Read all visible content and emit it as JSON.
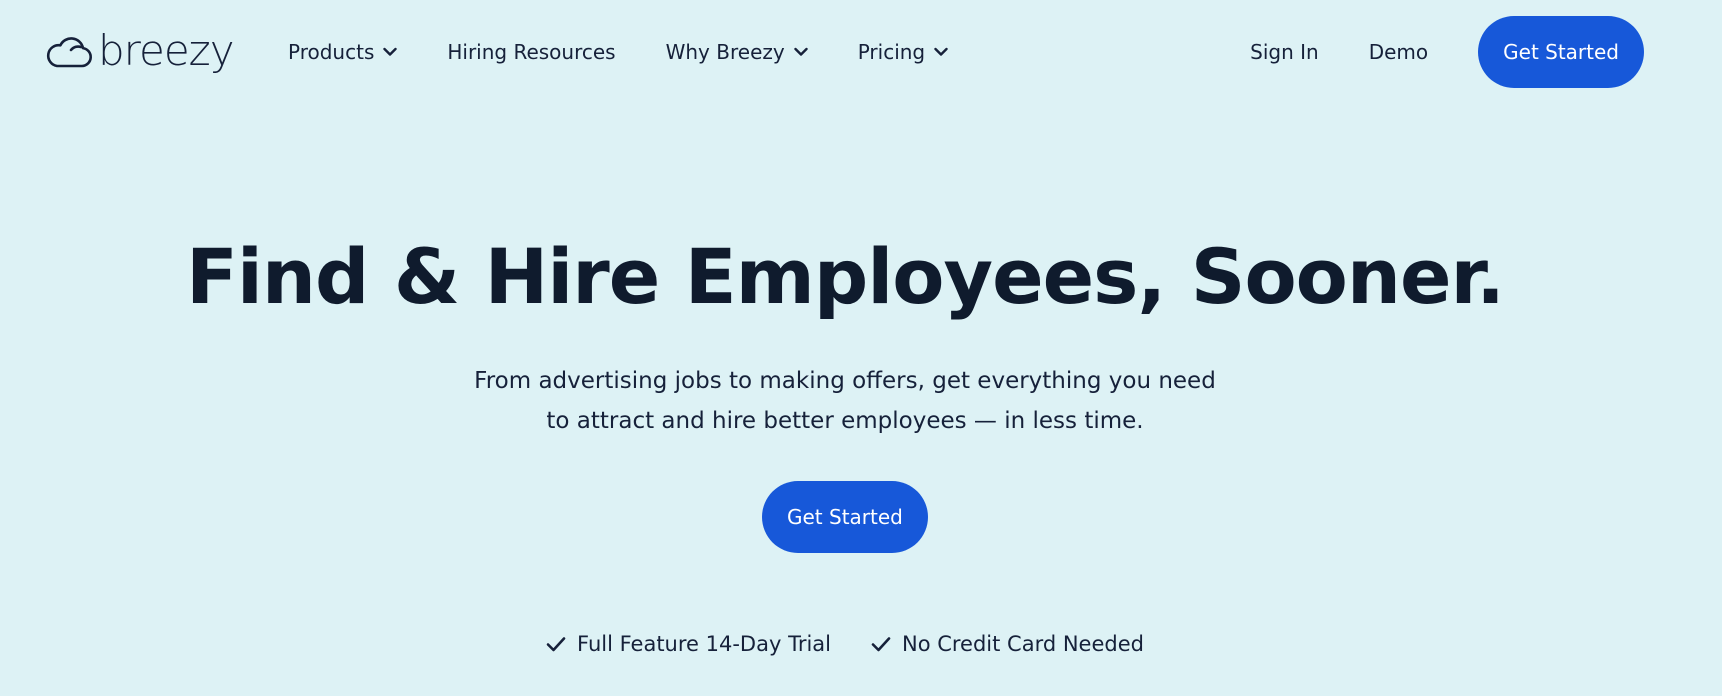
{
  "brand": {
    "logo_text": "breezy",
    "logo_icon": "cloud-icon"
  },
  "nav": {
    "items": [
      {
        "label": "Products",
        "has_dropdown": true
      },
      {
        "label": "Hiring Resources",
        "has_dropdown": false
      },
      {
        "label": "Why Breezy",
        "has_dropdown": true
      },
      {
        "label": "Pricing",
        "has_dropdown": true
      }
    ],
    "sign_in": "Sign In",
    "demo": "Demo",
    "get_started": "Get Started"
  },
  "hero": {
    "title": "Find & Hire Employees, Sooner.",
    "subtitle_line1": "From advertising jobs to making offers, get everything you need",
    "subtitle_line2": "to attract and hire better employees — in less time.",
    "cta": "Get Started",
    "perks": [
      {
        "label": "Full Feature 14-Day Trial",
        "icon": "check-icon"
      },
      {
        "label": "No Credit Card Needed",
        "icon": "check-icon"
      }
    ]
  },
  "colors": {
    "background": "#ddf2f5",
    "primary": "#1758d9",
    "text": "#0f1b2d"
  }
}
